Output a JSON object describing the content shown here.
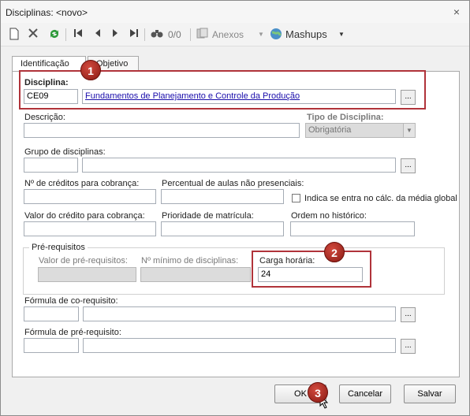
{
  "window": {
    "title": "Disciplinas: <novo>",
    "close_glyph": "×"
  },
  "toolbar": {
    "counter": "0/0",
    "anexos_label": "Anexos",
    "mashups_label": "Mashups",
    "icons": [
      "new-icon",
      "delete-icon",
      "refresh-icon",
      "first-icon",
      "prev-icon",
      "next-icon",
      "last-icon",
      "binoculars-icon",
      "attachment-icon",
      "mashups-icon"
    ]
  },
  "tabs": [
    {
      "label": "Identificação"
    },
    {
      "label": "Objetivo"
    }
  ],
  "form": {
    "disciplina_label": "Disciplina:",
    "disciplina_code": "CE09",
    "disciplina_name": "Fundamentos de Planejamento e Controle da Produção",
    "descricao_label": "Descrição:",
    "tipo_label": "Tipo de Disciplina:",
    "tipo_value": "Obrigatória",
    "grupo_label": "Grupo de disciplinas:",
    "creditos_label": "Nº de créditos para cobrança:",
    "percentual_label": "Percentual de aulas não presenciais:",
    "indica_label": "Indica se entra no cálc. da média global",
    "valor_credito_label": "Valor do crédito para cobrança:",
    "prioridade_label": "Prioridade de matrícula:",
    "ordem_label": "Ordem no histórico:",
    "prereq_group_label": "Pré-requisitos",
    "valor_prereq_label": "Valor de pré-requisitos:",
    "min_disciplinas_label": "Nº mínimo de disciplinas:",
    "carga_label": "Carga horária:",
    "carga_value": "24",
    "co_req_label": "Fórmula de co-requisito:",
    "pre_req_label": "Fórmula de pré-requisito:"
  },
  "buttons": {
    "ok": "OK",
    "cancel": "Cancelar",
    "save": "Salvar",
    "ellipsis": "..."
  },
  "badges": [
    "1",
    "2",
    "3"
  ],
  "colors": {
    "highlight_red": "#b0333a",
    "badge_red": "#b3261e",
    "link_blue": "#1a0dab"
  }
}
